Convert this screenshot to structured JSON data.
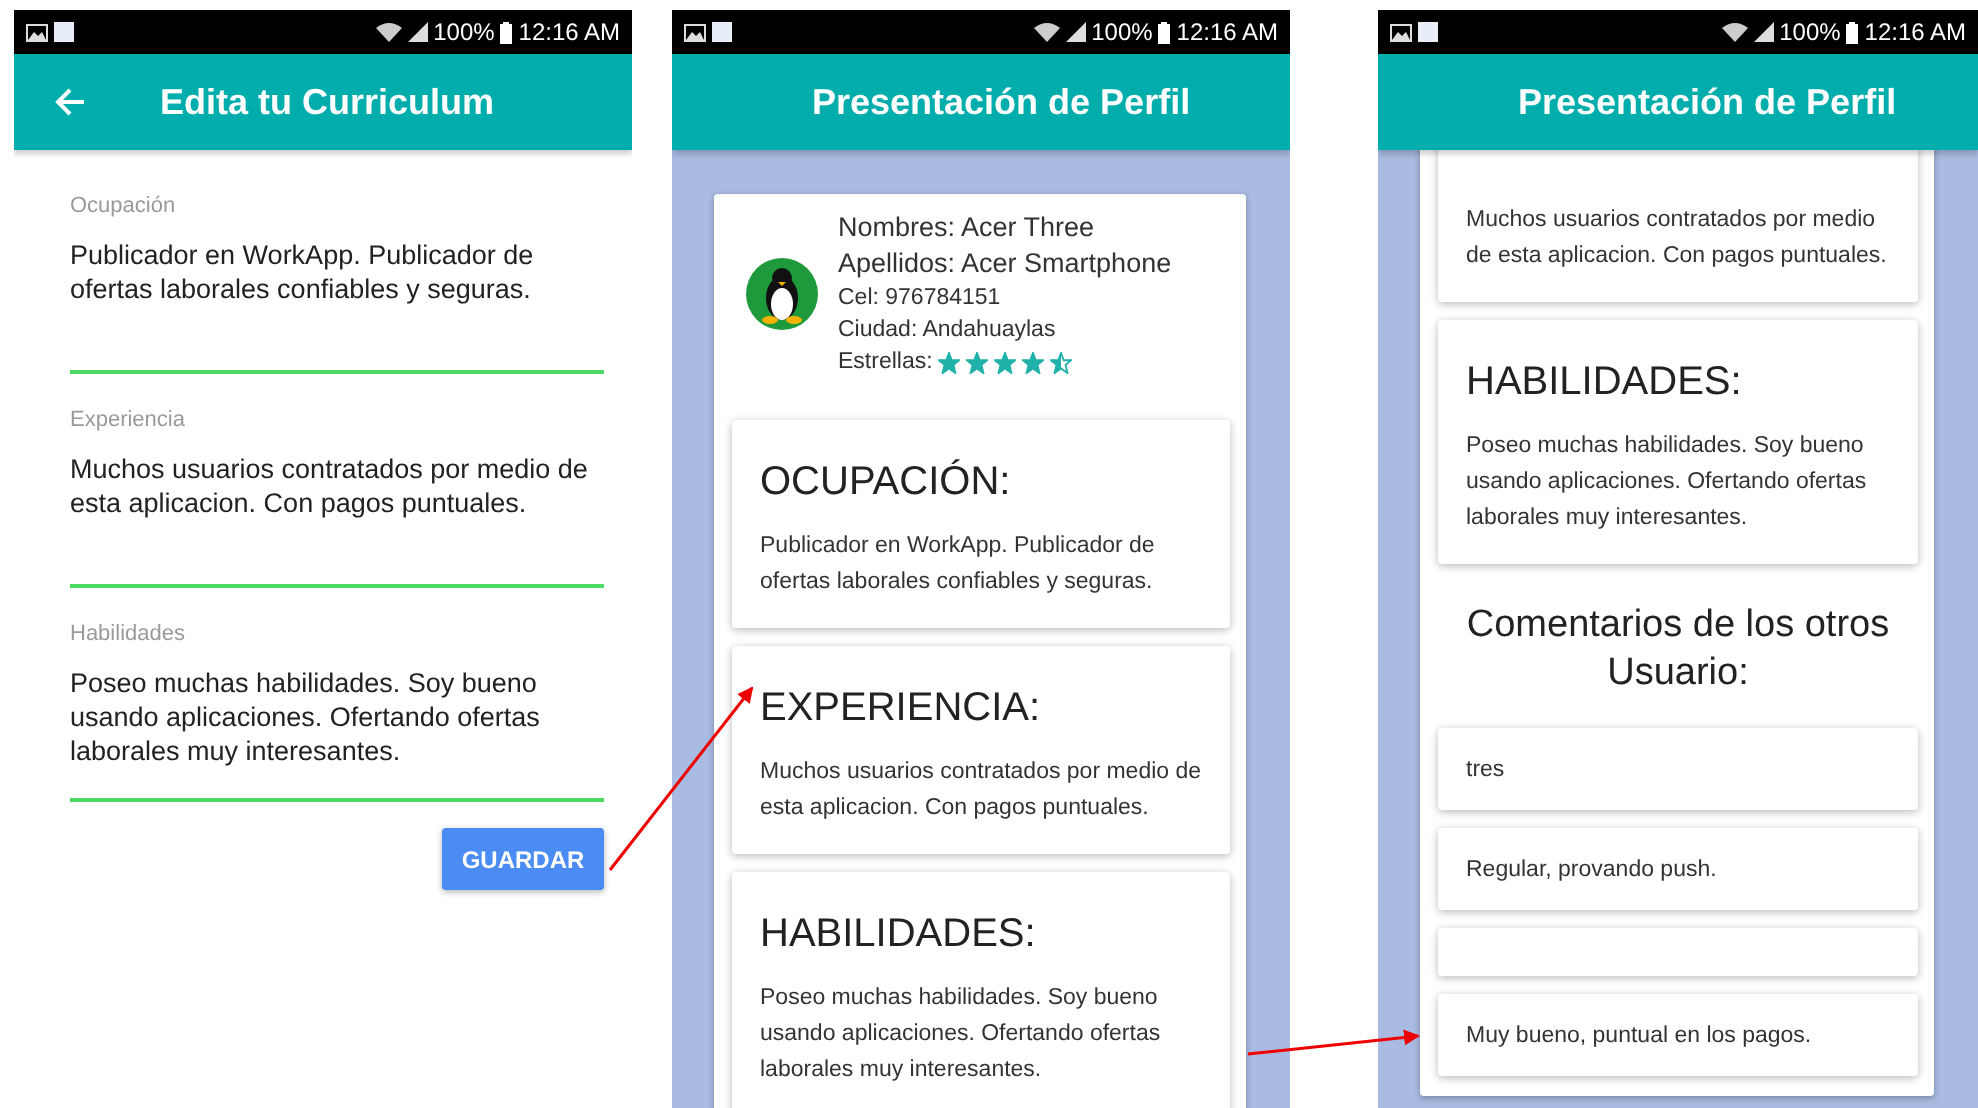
{
  "edit_screen": {
    "status_bar": {
      "battery": "100%",
      "time": "12:16 AM"
    },
    "app_bar": {
      "title": "Edita tu Curriculum"
    },
    "fields": [
      {
        "label": "Ocupación",
        "value": "Publicador en WorkApp. Publicador de ofertas laborales confiables y seguras."
      },
      {
        "label": "Experiencia",
        "value": "Muchos usuarios contratados por medio de esta aplicacion. Con pagos puntuales."
      },
      {
        "label": "Habilidades",
        "value": "Poseo muchas habilidades. Soy bueno usando aplicaciones. Ofertando ofertas laborales muy interesantes."
      }
    ],
    "save_button": "GUARDAR"
  },
  "profile_screen": {
    "status_bar": {
      "battery": "100%",
      "time": "12:16 AM"
    },
    "app_bar": {
      "title": "Presentación de Perfil"
    },
    "profile": {
      "name": "Nombres: Acer Three",
      "surname": "Apellidos: Acer Smartphone",
      "phone": "Cel: 976784151",
      "city": "Ciudad: Andahuaylas",
      "stars_label": "Estrellas:",
      "stars": 4.5
    },
    "sections": [
      {
        "heading": "OCUPACIÓN:",
        "text": "Publicador en WorkApp. Publicador de ofertas laborales confiables y seguras."
      },
      {
        "heading": "EXPERIENCIA:",
        "text": "Muchos usuarios contratados por medio de esta aplicacion. Con pagos puntuales."
      },
      {
        "heading": "HABILIDADES:",
        "text": "Poseo muchas habilidades. Soy bueno usando aplicaciones. Ofertando ofertas laborales muy interesantes."
      }
    ]
  },
  "profile_screen_scrolled": {
    "status_bar": {
      "battery": "100%",
      "time": "12:16 AM"
    },
    "app_bar": {
      "title": "Presentación de Perfil"
    },
    "sections": [
      {
        "text": "Muchos usuarios contratados por medio de esta aplicacion. Con pagos puntuales."
      },
      {
        "heading": "HABILIDADES:",
        "text": "Poseo muchas habilidades. Soy bueno usando aplicaciones. Ofertando ofertas laborales muy interesantes."
      }
    ],
    "comments_title": "Comentarios de los otros Usuario:",
    "comments": [
      {
        "kind": "text",
        "text": "tres"
      },
      {
        "kind": "text",
        "text": "Regular, provando push."
      },
      {
        "kind": "blank"
      },
      {
        "kind": "text",
        "text": "Muy bueno, puntual en los pagos."
      }
    ]
  }
}
